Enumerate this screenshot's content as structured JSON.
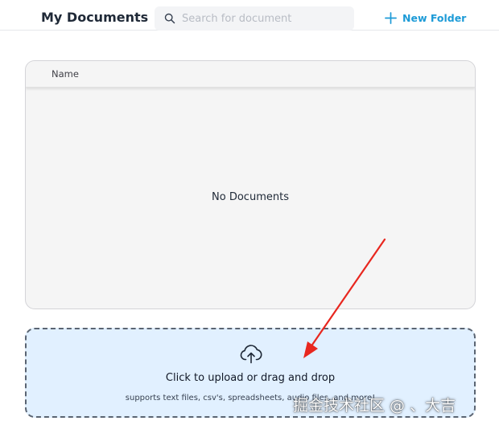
{
  "header": {
    "title": "My Documents",
    "search_placeholder": "Search for document",
    "search_value": "",
    "new_folder_label": "New Folder",
    "accent_color": "#1d9bd7"
  },
  "table": {
    "columns": [
      "Name"
    ],
    "empty_message": "No Documents"
  },
  "upload": {
    "title": "Click to upload or drag and drop",
    "subtitle": "supports text files, csv's, spreadsheets, audio files, and more!",
    "icon": "cloud-upload-icon",
    "background_color": "#e1f0ff"
  },
  "annotation": {
    "arrow_color": "#e8271f"
  },
  "watermark": {
    "text": "掘金技术社区 @ 、大吉"
  }
}
